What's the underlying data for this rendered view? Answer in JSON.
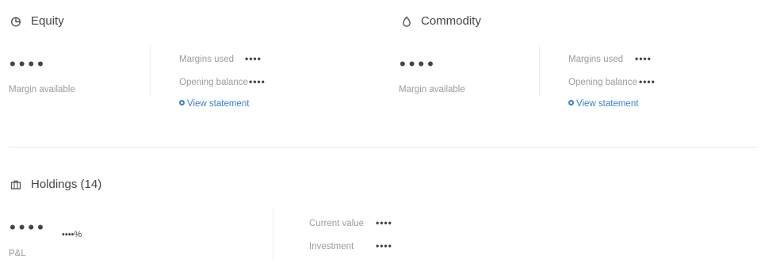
{
  "equity": {
    "title": "Equity",
    "icon": "pie-chart-icon",
    "margin_available_value": "••••",
    "margin_available_label": "Margin available",
    "margins_used_label": "Margins used",
    "margins_used_value": "••••",
    "opening_balance_label": "Opening balance",
    "opening_balance_value": "••••",
    "view_statement_label": "View statement"
  },
  "commodity": {
    "title": "Commodity",
    "icon": "drop-icon",
    "margin_available_value": "••••",
    "margin_available_label": "Margin available",
    "margins_used_label": "Margins used",
    "margins_used_value": "••••",
    "opening_balance_label": "Opening balance",
    "opening_balance_value": "••••",
    "view_statement_label": "View statement"
  },
  "holdings": {
    "title": "Holdings (14)",
    "icon": "briefcase-icon",
    "pnl_value": "••••",
    "pnl_pct": "••••%",
    "pnl_label": "P&L",
    "current_value_label": "Current value",
    "current_value_value": "••••",
    "investment_label": "Investment",
    "investment_value": "••••"
  },
  "colors": {
    "link": "#387ed1",
    "text": "#444444",
    "muted": "#9b9b9b",
    "divider": "#eeeeee"
  }
}
